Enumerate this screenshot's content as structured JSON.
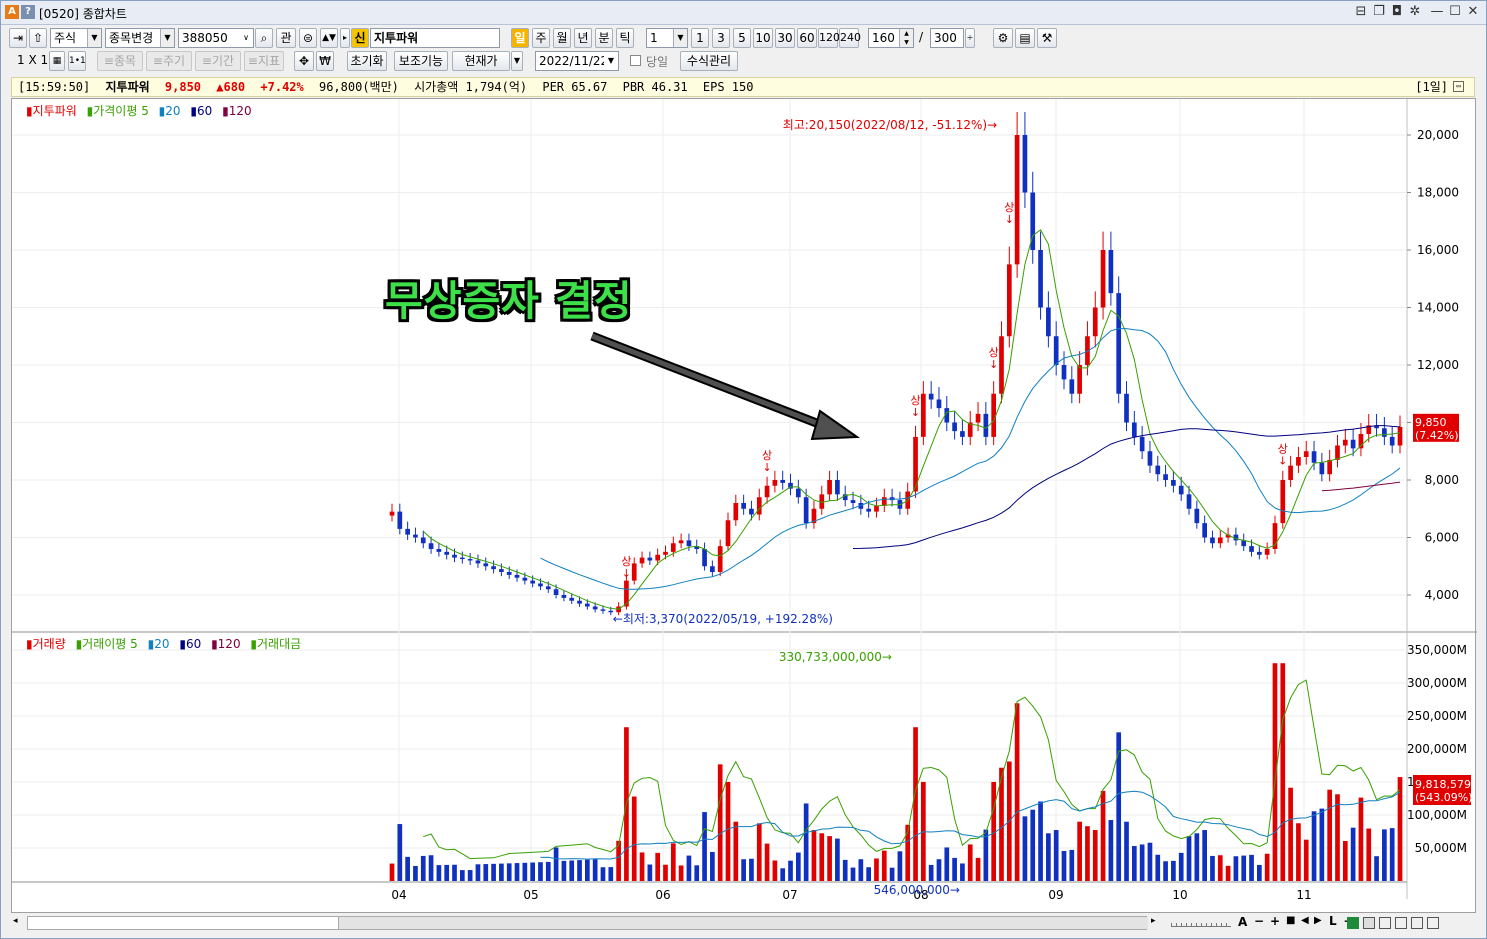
{
  "window": {
    "title": "[0520] 종합차트",
    "app_icons": [
      "A",
      "?"
    ]
  },
  "toolbar1": {
    "market": "주식",
    "code_change": "종목변경",
    "code": "388050",
    "gwan": "관",
    "sin": "신",
    "stock_name": "지투파워",
    "periods": [
      "일",
      "주",
      "월",
      "년",
      "분",
      "틱"
    ],
    "interval": "1",
    "quick_intervals": [
      "1",
      "3",
      "5",
      "10",
      "30",
      "60",
      "120",
      "240"
    ],
    "view_count": "160",
    "slash": "/",
    "total_count": "300"
  },
  "toolbar2": {
    "layout": "1 X 1",
    "layout_small": "1•1",
    "disabled": [
      "≡종목",
      "≡주기",
      "≡기간",
      "≡지표"
    ],
    "reset": "초기화",
    "aux": "보조기능",
    "price_type": "현재가",
    "date": "2022/11/22",
    "same_day": "당일",
    "formula": "수식관리"
  },
  "infobar": {
    "time": "[15:59:50]",
    "name": "지투파워",
    "price": "9,850",
    "change": "▲680",
    "rate": "+7.42%",
    "volume_amount": "96,800(백만)",
    "mcap": "시가총액 1,794(억)",
    "per": "PER 65.67",
    "pbr": "PBR 46.31",
    "eps": "EPS 150",
    "period_badge": "[1일]"
  },
  "price_legend": [
    "지투파워",
    "가격이평 5",
    "20",
    "60",
    "120"
  ],
  "volume_legend": [
    "거래량",
    "거래이평 5",
    "20",
    "60",
    "120",
    "거래대금"
  ],
  "annotation": "무상증자 결정",
  "chart_data": [
    {
      "type": "candlestick",
      "name": "지투파워",
      "y_ticks": [
        "20,000",
        "18,000",
        "16,000",
        "14,000",
        "12,000",
        "10,000",
        "8,000",
        "6,000",
        "4,000"
      ],
      "ylim": [
        3000,
        21000
      ],
      "x_ticks": [
        "04",
        "05",
        "06",
        "07",
        "08",
        "09",
        "10",
        "11"
      ],
      "high_label": "최고:20,150(2022/08/12, -51.12%)",
      "low_label": "최저:3,370(2022/05/19, +192.28%)",
      "limit_up_marker": "상",
      "last_price_label": "9,850",
      "last_rate_label": "(7.42%)",
      "closes": [
        6900,
        6300,
        6100,
        6000,
        5800,
        5600,
        5500,
        5400,
        5300,
        5250,
        5200,
        5100,
        5000,
        4900,
        4800,
        4700,
        4600,
        4500,
        4400,
        4300,
        4200,
        4000,
        3900,
        3800,
        3700,
        3600,
        3500,
        3450,
        3400,
        3600,
        4500,
        5100,
        5300,
        5200,
        5400,
        5500,
        5800,
        5900,
        5700,
        5600,
        5000,
        4800,
        5700,
        6600,
        7200,
        7000,
        6800,
        7400,
        7800,
        8000,
        7900,
        7700,
        7400,
        6500,
        7000,
        7500,
        8000,
        7500,
        7300,
        7200,
        7000,
        6900,
        7100,
        7400,
        7300,
        7000,
        7600,
        9500,
        11000,
        10800,
        10500,
        10000,
        9700,
        9500,
        10000,
        10300,
        9500,
        11000,
        13000,
        15500,
        20000,
        18000,
        16000,
        14000,
        13000,
        12000,
        11500,
        11000,
        12000,
        13000,
        14000,
        16000,
        14500,
        11000,
        10000,
        9500,
        9000,
        8500,
        8200,
        8000,
        7800,
        7500,
        7000,
        6500,
        6000,
        5800,
        6000,
        6100,
        5900,
        5700,
        5500,
        5400,
        5600,
        6500,
        8000,
        8500,
        8800,
        9000,
        8600,
        8200,
        8700,
        9200,
        9400,
        9100,
        9600,
        9900,
        9800,
        9500,
        9200,
        9850
      ]
    },
    {
      "type": "bar",
      "name": "거래량",
      "y_ticks": [
        "350,000M",
        "300,000M",
        "250,000M",
        "200,000M",
        "150,000M",
        "100,000M",
        "50,000M"
      ],
      "ylim": [
        0,
        350000
      ],
      "max_label": "330,733,000,000",
      "min_label": "546,000,000",
      "last_value_label": "9,818,579",
      "last_rate_label": "(543.09%)"
    }
  ],
  "bottom": {
    "zoom_icons": [
      "A",
      "−",
      "+",
      "■",
      "L",
      "→"
    ]
  }
}
